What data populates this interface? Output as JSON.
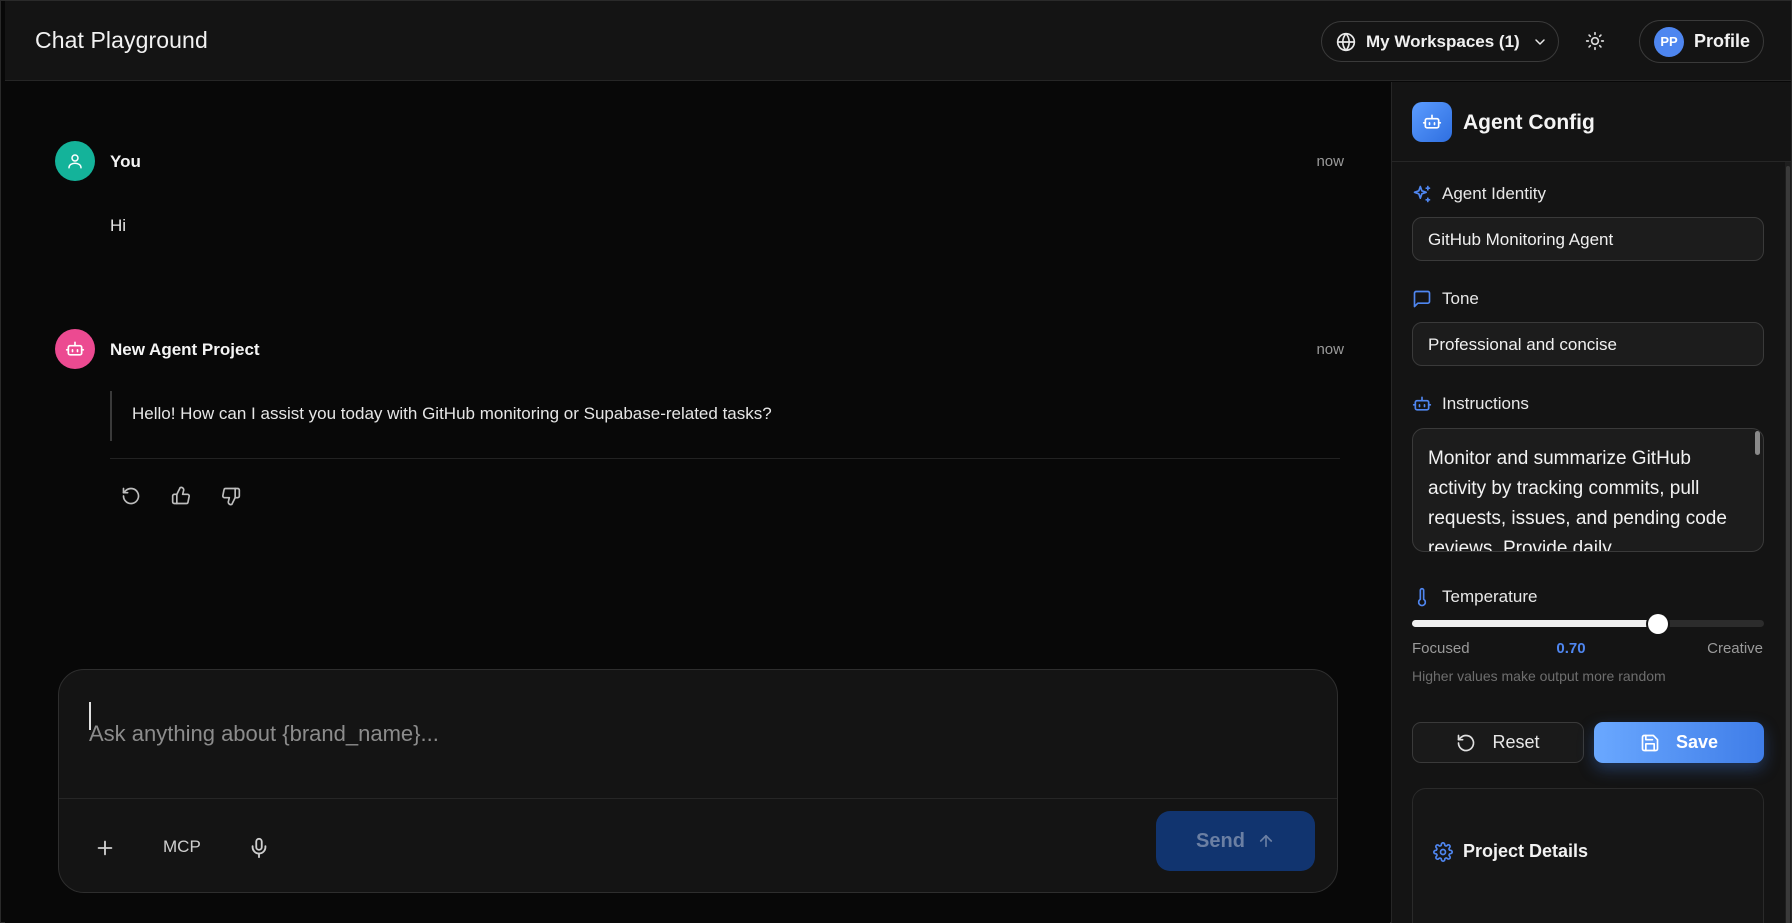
{
  "header": {
    "title": "Chat Playground",
    "workspaces_label": "My Workspaces (1)",
    "profile_initials": "PP",
    "profile_label": "Profile"
  },
  "chat": {
    "messages": [
      {
        "author": "You",
        "time": "now",
        "text": "Hi"
      },
      {
        "author": "New Agent Project",
        "time": "now",
        "text": "Hello! How can I assist you today with GitHub monitoring or Supabase-related tasks?"
      }
    ]
  },
  "composer": {
    "placeholder": "Ask anything about {brand_name}...",
    "mcp_label": "MCP",
    "send_label": "Send"
  },
  "panel": {
    "title": "Agent Config",
    "identity_label": "Agent Identity",
    "identity_value": "GitHub Monitoring Agent",
    "tone_label": "Tone",
    "tone_value": "Professional and concise",
    "instructions_label": "Instructions",
    "instructions_value": "Monitor and summarize GitHub activity by tracking commits, pull requests, issues, and pending code reviews. Provide daily",
    "temperature_label": "Temperature",
    "temperature_value": "0.70",
    "temperature_fraction": 0.7,
    "temperature_min_label": "Focused",
    "temperature_max_label": "Creative",
    "temperature_hint": "Higher values make output more random",
    "reset_label": "Reset",
    "save_label": "Save",
    "details_title": "Project Details"
  },
  "colors": {
    "accent": "#4f86f0",
    "user_avatar": "#14b39a",
    "bot_avatar": "#ec4a91",
    "send_button": "#11346f"
  },
  "icons": {
    "workspaces": "globe-icon",
    "theme": "sun-icon",
    "user_avatar": "user-icon",
    "bot_avatar": "bot-icon",
    "actions": [
      "regenerate-icon",
      "thumbs-up-icon",
      "thumbs-down-icon"
    ],
    "identity": "sparkles-icon",
    "tone": "message-square-icon",
    "instructions": "bot-icon",
    "temperature": "thermometer-icon",
    "details": "gear-icon"
  }
}
